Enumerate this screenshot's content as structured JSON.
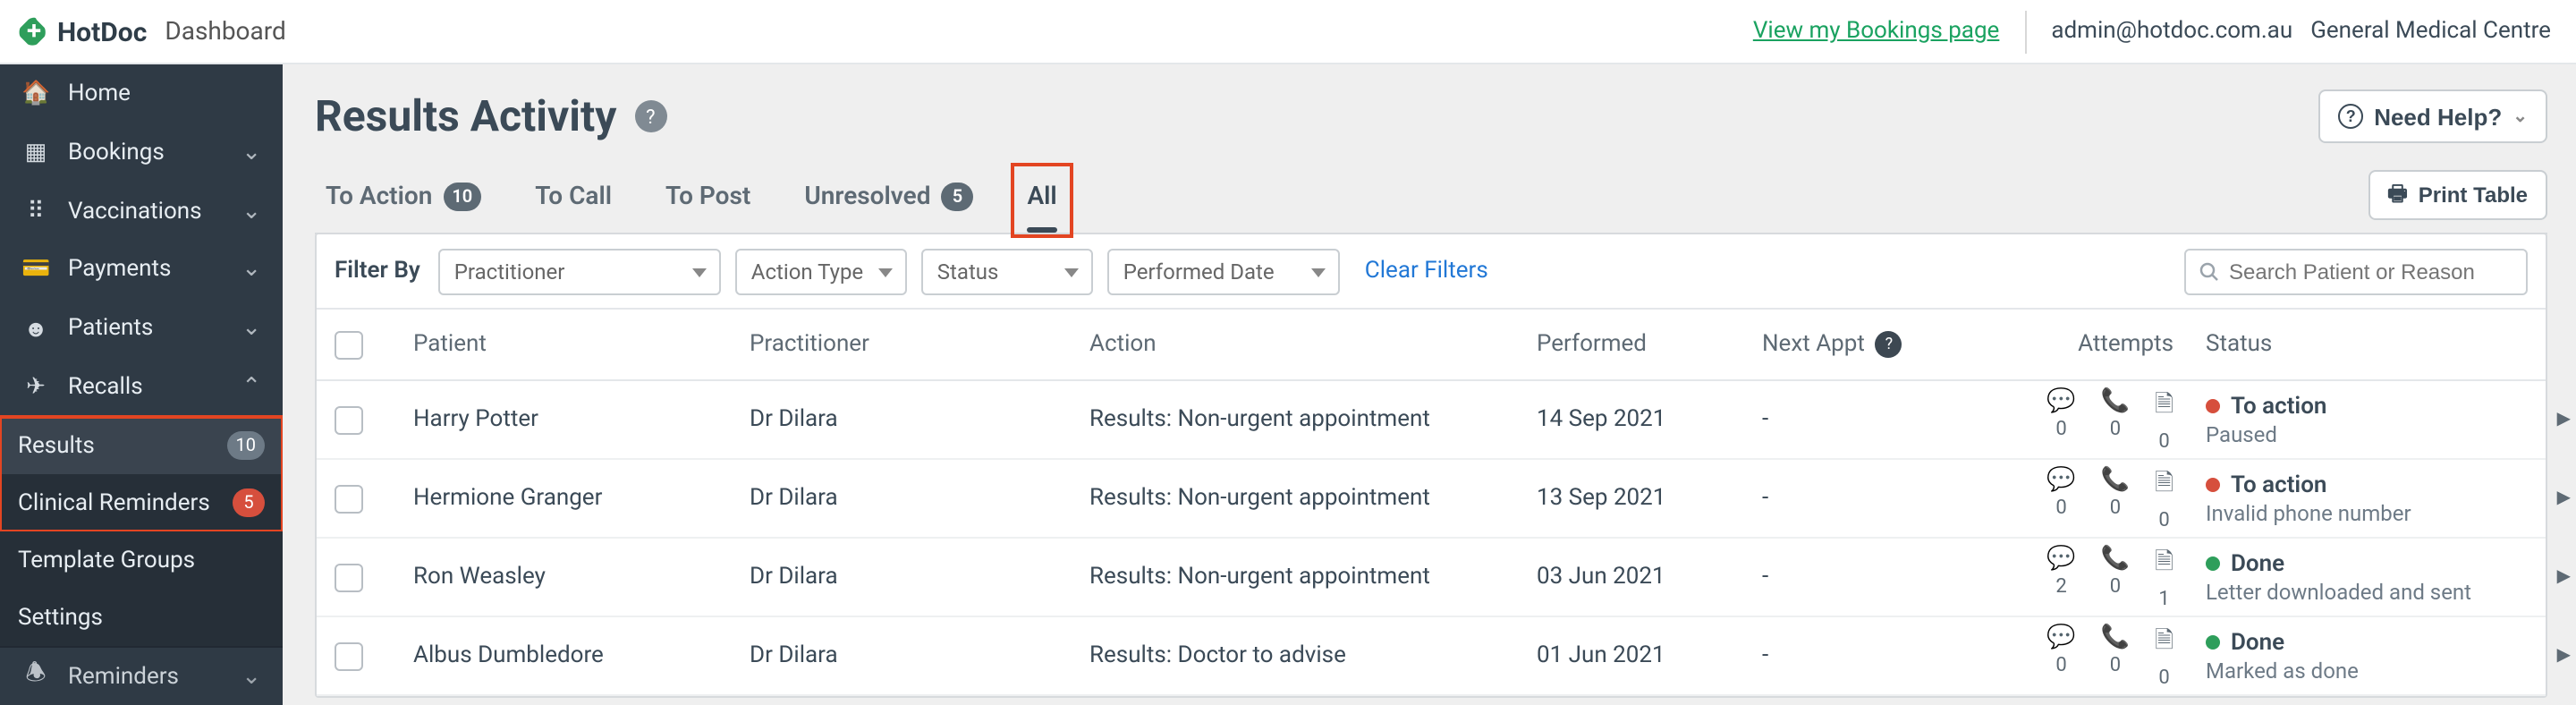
{
  "brand": {
    "name": "HotDoc",
    "section": "Dashboard"
  },
  "topbar": {
    "bookings_link": "View my Bookings page",
    "email": "admin@hotdoc.com.au",
    "centre": "General Medical Centre"
  },
  "sidebar": {
    "items": [
      {
        "label": "Home",
        "icon": "home-icon",
        "chevron": null
      },
      {
        "label": "Bookings",
        "icon": "calendar-icon",
        "chevron": "down"
      },
      {
        "label": "Vaccinations",
        "icon": "vaccine-icon",
        "chevron": "down"
      },
      {
        "label": "Payments",
        "icon": "card-icon",
        "chevron": "down"
      },
      {
        "label": "Patients",
        "icon": "user-icon",
        "chevron": "down"
      },
      {
        "label": "Recalls",
        "icon": "send-icon",
        "chevron": "up"
      }
    ],
    "recalls_sub": [
      {
        "label": "Results",
        "badge": "10",
        "badge_style": "grey",
        "active": true
      },
      {
        "label": "Clinical Reminders",
        "badge": "5",
        "badge_style": "red",
        "active": false
      },
      {
        "label": "Template Groups",
        "badge": null
      },
      {
        "label": "Settings",
        "badge": null
      }
    ],
    "reminders_label": "Reminders"
  },
  "page": {
    "title": "Results Activity",
    "need_help": "Need Help?",
    "print": "Print Table"
  },
  "tabs": [
    {
      "label": "To Action",
      "badge": "10"
    },
    {
      "label": "To Call",
      "badge": null
    },
    {
      "label": "To Post",
      "badge": null
    },
    {
      "label": "Unresolved",
      "badge": "5"
    },
    {
      "label": "All",
      "badge": null,
      "active": true
    }
  ],
  "filters": {
    "label": "Filter By",
    "practitioner_ph": "Practitioner",
    "action_ph": "Action Type",
    "status_ph": "Status",
    "date_ph": "Performed Date",
    "clear": "Clear Filters",
    "search_ph": "Search Patient or Reason"
  },
  "columns": {
    "patient": "Patient",
    "practitioner": "Practitioner",
    "action": "Action",
    "performed": "Performed",
    "next_appt": "Next Appt",
    "attempts": "Attempts",
    "status": "Status"
  },
  "rows": [
    {
      "patient": "Harry Potter",
      "practitioner": "Dr Dilara",
      "action": "Results: Non-urgent appointment",
      "performed": "14 Sep 2021",
      "next": "-",
      "att_msg": "0",
      "att_phone": "0",
      "att_doc": "0",
      "status1": "To action",
      "status2": "Paused",
      "dot": "red"
    },
    {
      "patient": "Hermione Granger",
      "practitioner": "Dr Dilara",
      "action": "Results: Non-urgent appointment",
      "performed": "13 Sep 2021",
      "next": "-",
      "att_msg": "0",
      "att_phone": "0",
      "att_doc": "0",
      "status1": "To action",
      "status2": "Invalid phone number",
      "dot": "red"
    },
    {
      "patient": "Ron Weasley",
      "practitioner": "Dr Dilara",
      "action": "Results: Non-urgent appointment",
      "performed": "03 Jun 2021",
      "next": "-",
      "att_msg": "2",
      "att_phone": "0",
      "att_doc": "1",
      "status1": "Done",
      "status2": "Letter downloaded and sent",
      "dot": "green"
    },
    {
      "patient": "Albus Dumbledore",
      "practitioner": "Dr Dilara",
      "action": "Results: Doctor to advise",
      "performed": "01 Jun 2021",
      "next": "-",
      "att_msg": "0",
      "att_phone": "0",
      "att_doc": "0",
      "status1": "Done",
      "status2": "Marked as done",
      "dot": "green"
    }
  ]
}
